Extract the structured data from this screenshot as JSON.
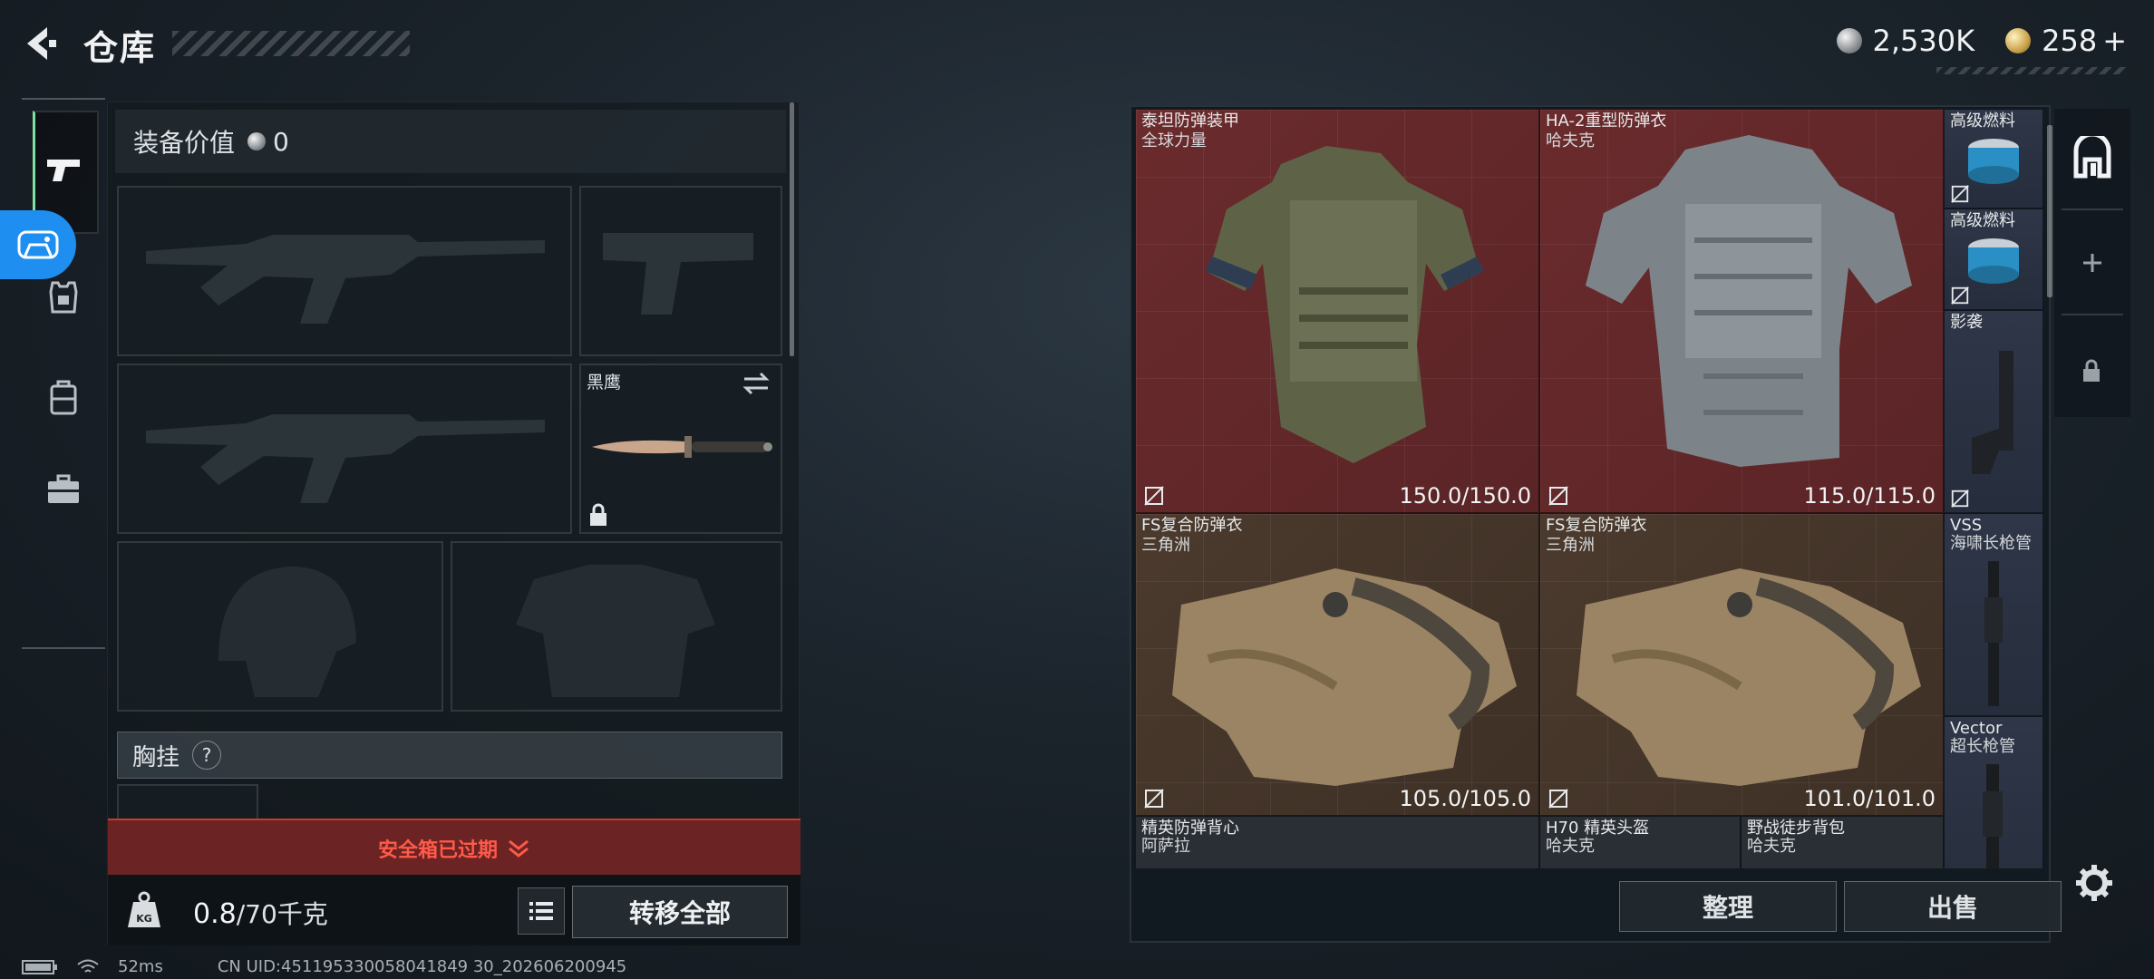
{
  "header": {
    "title": "仓库",
    "currency_silver": "2,530K",
    "currency_gold": "258",
    "add_label": "+"
  },
  "loadout": {
    "equip_value_label": "装备价值",
    "equip_value": "0",
    "knife_name": "黑鹰",
    "chest_label": "胸挂",
    "help_label": "?",
    "warning": "安全箱已过期",
    "weight_current": "0.8",
    "weight_max": "/70千克",
    "transfer_all": "转移全部"
  },
  "storage": {
    "items": [
      {
        "name": "泰坦防弹装甲",
        "sub": "全球力量",
        "durability": "150.0/150.0"
      },
      {
        "name": "HA-2重型防弹衣",
        "sub": "哈夫克",
        "durability": "115.0/115.0"
      },
      {
        "name": "FS复合防弹衣",
        "sub": "三角洲",
        "durability": "105.0/105.0"
      },
      {
        "name": "FS复合防弹衣",
        "sub": "三角洲",
        "durability": "101.0/101.0"
      },
      {
        "name": "精英防弹背心",
        "sub": "阿萨拉"
      },
      {
        "name": "H70 精英头盔",
        "sub": "哈夫克"
      },
      {
        "name": "野战徒步背包",
        "sub": "哈夫克"
      }
    ],
    "side_items": [
      {
        "name": "高级燃料"
      },
      {
        "name": "高级燃料"
      },
      {
        "name": "影袭"
      },
      {
        "name": "VSS",
        "sub": "海啸长枪管"
      },
      {
        "name": "Vector",
        "sub": "超长枪管"
      }
    ],
    "sort_label": "整理",
    "sell_label": "出售"
  },
  "status_bar": {
    "ping": "52ms",
    "uid": "CN UID:451195330058041849 30_202606200945"
  },
  "colors": {
    "accent_blue": "#1e8ef0",
    "warning_red": "#ff5a4a",
    "item_red_bg": "#6b2b2d",
    "item_brown_bg": "#4b3a2d"
  }
}
